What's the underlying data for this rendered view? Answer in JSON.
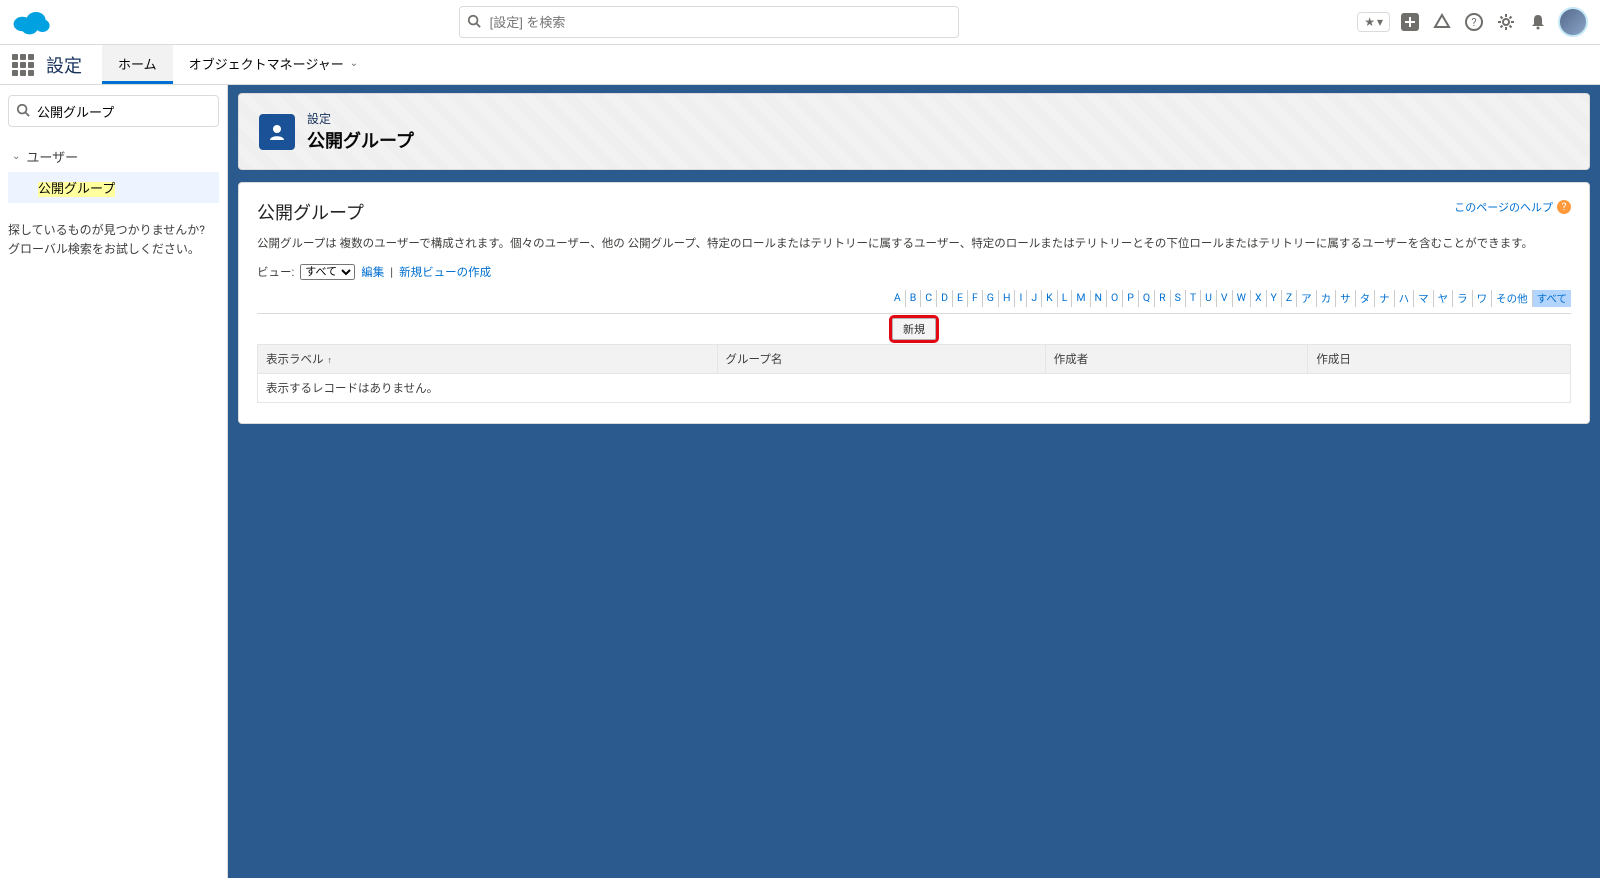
{
  "header": {
    "search_placeholder": "[設定] を検索",
    "fav_label": "★",
    "fav_chev": "▾"
  },
  "nav": {
    "app_name": "設定",
    "tabs": [
      {
        "label": "ホーム",
        "active": true,
        "has_chevron": false
      },
      {
        "label": "オブジェクトマネージャー",
        "active": false,
        "has_chevron": true
      }
    ]
  },
  "sidebar": {
    "search_value": "公開グループ",
    "tree": {
      "section_label": "ユーザー",
      "item_label": "公開グループ"
    },
    "hint_line1": "探しているものが見つかりませんか?",
    "hint_line2": "グローバル検索をお試しください。"
  },
  "page": {
    "crumb": "設定",
    "title": "公開グループ",
    "card_title": "公開グループ",
    "help_label": "このページのヘルプ",
    "description": "公開グループは 複数のユーザーで構成されます。個々のユーザー、他の 公開グループ、特定のロールまたはテリトリーに属するユーザー、特定のロールまたはテリトリーとその下位ロールまたはテリトリーに属するユーザーを含むことができます。",
    "view_label": "ビュー:",
    "view_selected": "すべて",
    "edit_link": "編集",
    "create_view_link": "新規ビューの作成",
    "new_button": "新規",
    "alphabet": [
      "A",
      "B",
      "C",
      "D",
      "E",
      "F",
      "G",
      "H",
      "I",
      "J",
      "K",
      "L",
      "M",
      "N",
      "O",
      "P",
      "Q",
      "R",
      "S",
      "T",
      "U",
      "V",
      "W",
      "X",
      "Y",
      "Z",
      "ア",
      "カ",
      "サ",
      "タ",
      "ナ",
      "ハ",
      "マ",
      "ヤ",
      "ラ",
      "ワ",
      "その他",
      "すべて"
    ],
    "alphabet_active": "すべて",
    "columns": {
      "c1": "表示ラベル",
      "c1_sort": "↑",
      "c2": "グループ名",
      "c3": "作成者",
      "c4": "作成日"
    },
    "empty_row": "表示するレコードはありません。"
  }
}
